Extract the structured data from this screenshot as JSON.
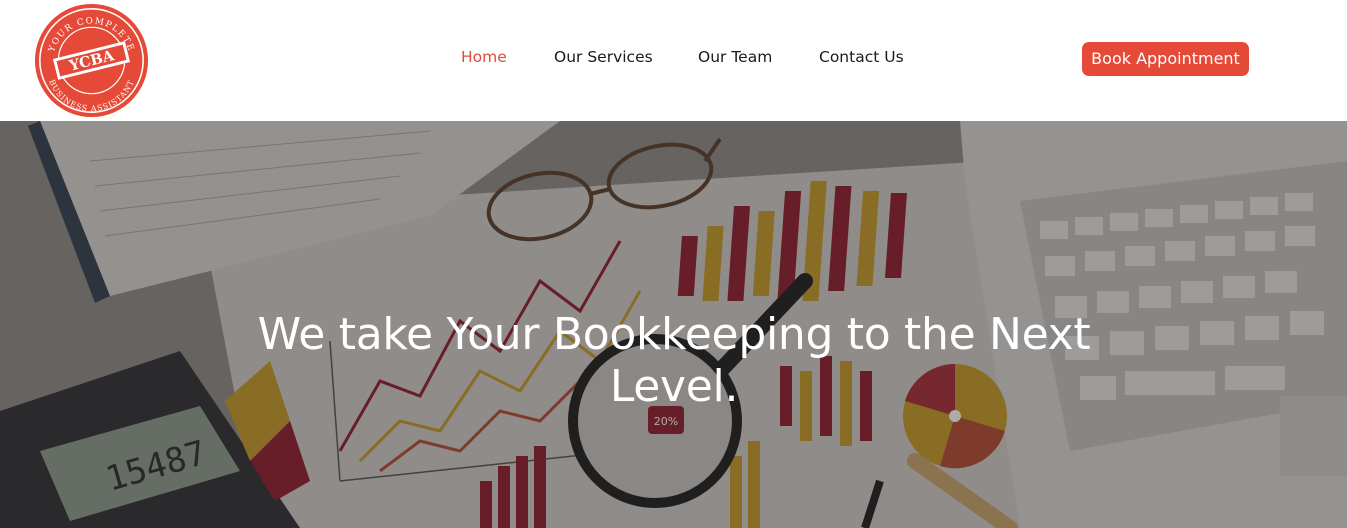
{
  "brand": {
    "logo_top_text": "YOUR COMPLETE",
    "logo_center_text": "YCBA",
    "logo_bottom_text": "BUSINESS ASSISTANT",
    "color": "#e54a38"
  },
  "nav": {
    "items": [
      {
        "label": "Home",
        "active": true
      },
      {
        "label": "Our Services",
        "active": false
      },
      {
        "label": "Our Team",
        "active": false
      },
      {
        "label": "Contact Us",
        "active": false
      }
    ],
    "active_color": "#e24b3b"
  },
  "cta": {
    "label": "Book Appointment"
  },
  "hero": {
    "title": "We take Your Bookkeeping to the Next Level.",
    "calculator_display": "15487",
    "badge_text": "20%"
  }
}
